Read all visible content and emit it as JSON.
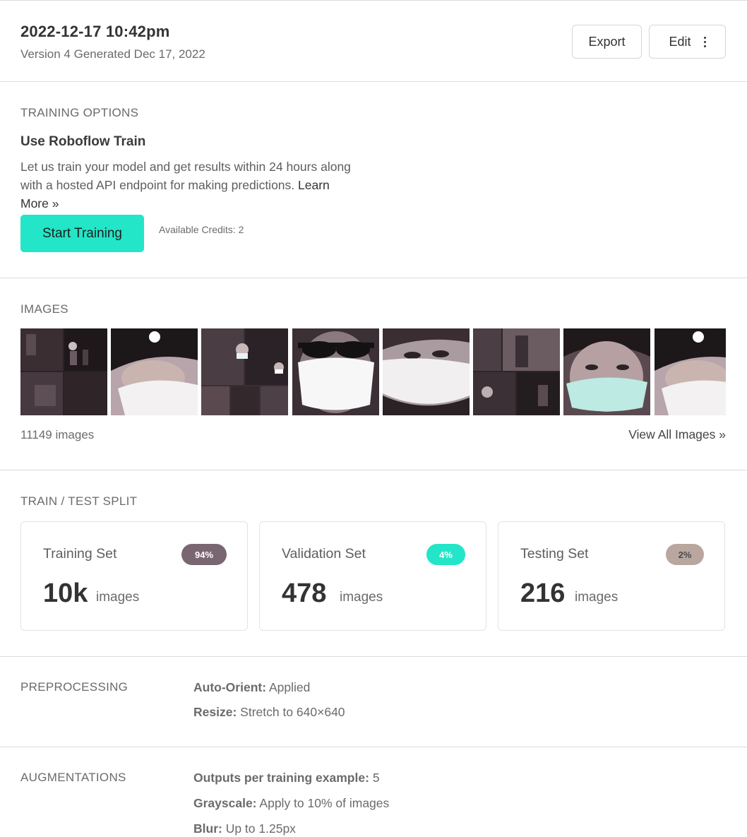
{
  "header": {
    "title": "2022-12-17 10:42pm",
    "subtitle": "Version 4 Generated Dec 17, 2022",
    "export_label": "Export",
    "edit_label": "Edit"
  },
  "training": {
    "section_label": "TRAINING OPTIONS",
    "heading": "Use Roboflow Train",
    "description": "Let us train your model and get results within 24 hours along with a hosted API endpoint for making predictions.",
    "learn_more": "Learn More »",
    "start_button": "Start Training",
    "credits": "Available Credits: 2"
  },
  "images": {
    "section_label": "IMAGES",
    "count": "11149 images",
    "view_all": "View All Images »"
  },
  "split": {
    "section_label": "TRAIN / TEST SPLIT",
    "cards": [
      {
        "title": "Training Set",
        "badge": "94%",
        "value": "10k",
        "unit": "images",
        "badge_color": "#7a6670",
        "badge_text_color": "#ffffff"
      },
      {
        "title": "Validation Set",
        "badge": "4%",
        "value": "478",
        "unit": "images",
        "badge_color": "#23e5c7",
        "badge_text_color": "#ffffff"
      },
      {
        "title": "Testing Set",
        "badge": "2%",
        "value": "216",
        "unit": "images",
        "badge_color": "#b9a79f",
        "badge_text_color": "#4a4a4a"
      }
    ]
  },
  "preprocessing": {
    "section_label": "PREPROCESSING",
    "items": [
      {
        "key": "Auto-Orient:",
        "value": "Applied"
      },
      {
        "key": "Resize:",
        "value": "Stretch to 640×640"
      }
    ]
  },
  "augmentations": {
    "section_label": "AUGMENTATIONS",
    "items": [
      {
        "key": "Outputs per training example:",
        "value": "5"
      },
      {
        "key": "Grayscale:",
        "value": "Apply to 10% of images"
      },
      {
        "key": "Blur:",
        "value": "Up to 1.25px"
      }
    ]
  }
}
